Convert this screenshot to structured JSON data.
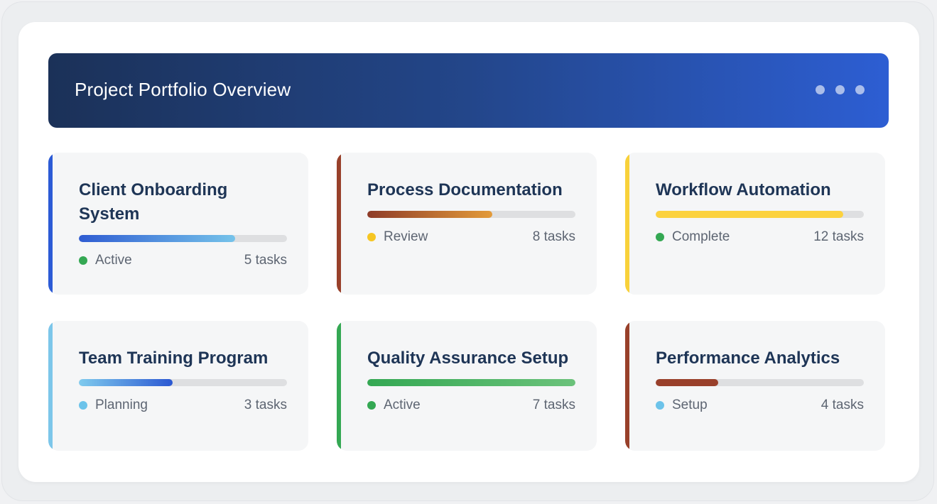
{
  "header": {
    "title": "Project Portfolio Overview",
    "menu_icon": "more-horizontal-icon"
  },
  "projects": [
    {
      "title": "Client Onboarding System",
      "status": "Active",
      "tasks": "5 tasks",
      "progress": 0.75,
      "accent": "#2c5bd6",
      "status_color": "#34a853",
      "fill": "linear-gradient(90deg, #2f5cd2, #75c3ea)"
    },
    {
      "title": "Process Documentation",
      "status": "Review",
      "tasks": "8 tasks",
      "progress": 0.6,
      "accent": "#98402a",
      "status_color": "#f6c623",
      "fill": "linear-gradient(90deg, #8e3b28, #e39b3a)"
    },
    {
      "title": "Workflow Automation",
      "status": "Complete",
      "tasks": "12 tasks",
      "progress": 0.9,
      "accent": "#f8d13a",
      "status_color": "#34a853",
      "fill": "#fcd23e"
    },
    {
      "title": "Team Training Program",
      "status": "Planning",
      "tasks": "3 tasks",
      "progress": 0.45,
      "accent": "#7cc6ea",
      "status_color": "#6cc3ea",
      "fill": "linear-gradient(90deg, #7fcbee, #2b58d2)"
    },
    {
      "title": "Quality Assurance Setup",
      "status": "Active",
      "tasks": "7 tasks",
      "progress": 1.0,
      "accent": "#34a853",
      "status_color": "#34a853",
      "fill": "linear-gradient(90deg, #34a853, #6bc27b)"
    },
    {
      "title": "Performance Analytics",
      "status": "Setup",
      "tasks": "4 tasks",
      "progress": 0.3,
      "accent": "#98402a",
      "status_color": "#6cc3ea",
      "fill": "#99402b"
    }
  ]
}
